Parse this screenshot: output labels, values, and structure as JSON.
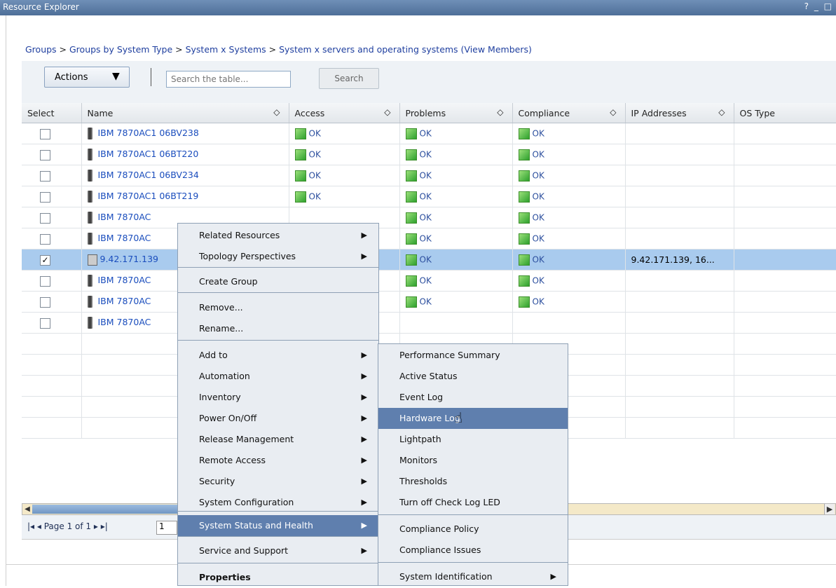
{
  "window": {
    "title": "Resource Explorer",
    "controls": "? _ □"
  },
  "breadcrumb": [
    "Groups",
    "Groups by System Type",
    "System x Systems",
    "System x servers and operating systems (View Members)"
  ],
  "breadcrumb_sep": " > ",
  "toolbar": {
    "actions_label": "Actions",
    "actions_arrow": "▼",
    "search_placeholder": "Search the table...",
    "search_label": "Search"
  },
  "table": {
    "columns": [
      "Select",
      "Name",
      "Access",
      "Problems",
      "Compliance",
      "IP Addresses",
      "OS Type"
    ],
    "sort_icon": "◇",
    "rows": [
      {
        "checked": "",
        "name": "IBM 7870AC1 06BV238",
        "access": "OK",
        "problems": "OK",
        "compliance": "OK",
        "ip": ""
      },
      {
        "checked": "",
        "name": "IBM 7870AC1 06BT220",
        "access": "OK",
        "problems": "OK",
        "compliance": "OK",
        "ip": ""
      },
      {
        "checked": "",
        "name": "IBM 7870AC1 06BV234",
        "access": "OK",
        "problems": "OK",
        "compliance": "OK",
        "ip": ""
      },
      {
        "checked": "",
        "name": "IBM 7870AC1 06BT219",
        "access": "OK",
        "problems": "OK",
        "compliance": "OK",
        "ip": ""
      },
      {
        "checked": "",
        "name": "IBM 7870AC",
        "access": "",
        "problems": "OK",
        "compliance": "OK",
        "ip": ""
      },
      {
        "checked": "",
        "name": "IBM 7870AC",
        "access": "",
        "problems": "OK",
        "compliance": "OK",
        "ip": ""
      },
      {
        "checked": "✓",
        "name": "9.42.171.139",
        "access": "",
        "problems": "OK",
        "compliance": "OK",
        "ip": "9.42.171.139, 16..."
      },
      {
        "checked": "",
        "name": "IBM 7870AC",
        "access": "",
        "problems": "OK",
        "compliance": "OK",
        "ip": ""
      },
      {
        "checked": "",
        "name": "IBM 7870AC",
        "access": "",
        "problems": "OK",
        "compliance": "OK",
        "ip": ""
      },
      {
        "checked": "",
        "name": "IBM 7870AC",
        "access": "",
        "problems": "",
        "compliance": "",
        "ip": ""
      }
    ]
  },
  "pager": {
    "nav": "|◂ ◂  Page 1 of 1  ▸ ▸|",
    "page_value": "1"
  },
  "context_menu": {
    "items": [
      "Related Resources",
      "Topology Perspectives",
      "Create Group",
      "Remove...",
      "Rename...",
      "Add to",
      "Automation",
      "Inventory",
      "Power On/Off",
      "Release Management",
      "Remote Access",
      "Security",
      "System Configuration",
      "System Status and Health",
      "Service and Support",
      "Properties"
    ],
    "submenu_arrow": "▶"
  },
  "sub_menu": {
    "items": [
      "Performance Summary",
      "Active Status",
      "Event Log",
      "Hardware Log",
      "Lightpath",
      "Monitors",
      "Thresholds",
      "Turn off Check Log LED",
      "Compliance Policy",
      "Compliance Issues",
      "System Identification"
    ]
  },
  "cursor": "☝"
}
